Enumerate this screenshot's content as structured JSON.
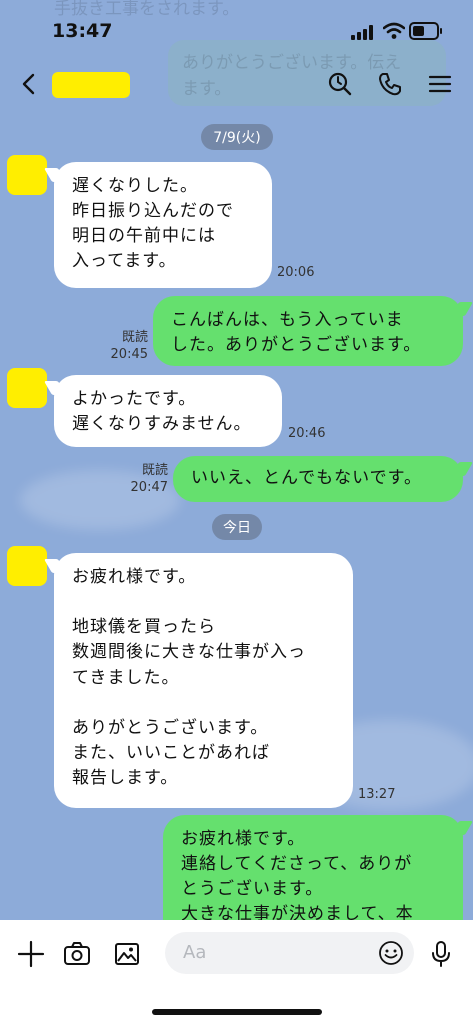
{
  "status_bar": {
    "time": "13:47"
  },
  "background_ghost": {
    "top_text": "手抜き工事をされます。",
    "bubble_line1": "ありがとうございます。伝え",
    "bubble_line2": "ます。"
  },
  "header": {
    "back_icon": "chevron-left-icon",
    "name_redacted": "",
    "icons": [
      "search-icon",
      "phone-icon",
      "menu-icon"
    ]
  },
  "dates": [
    "7/9(火)",
    "今日"
  ],
  "messages": [
    {
      "side": "in",
      "text": "遅くなりした。\n昨日振り込んだので\n明日の午前中には\n入ってます。",
      "time": "20:06"
    },
    {
      "side": "out",
      "text": "こんばんは、もう入っていま\nした。ありがとうございます。",
      "read": "既読",
      "time": "20:45"
    },
    {
      "side": "in",
      "text": "よかったです。\n遅くなりすみません。",
      "time": "20:46"
    },
    {
      "side": "out",
      "text": "いいえ、とんでもないです。",
      "read": "既読",
      "time": "20:47"
    },
    {
      "side": "in",
      "text": "お疲れ様です。\n\n地球儀を買ったら\n数週間後に大きな仕事が入っ\nてきました。\n\nありがとうございます。\nまた、いいことがあれば\n報告します。",
      "time": "13:27"
    },
    {
      "side": "out",
      "text": "お疲れ様です。\n連絡してくださって、ありが\nとうございます。\n大きな仕事が決めまして、本"
    }
  ],
  "input_bar": {
    "placeholder": "Aa",
    "icons": [
      "plus-icon",
      "camera-icon",
      "image-icon",
      "emoji-icon",
      "microphone-icon"
    ]
  },
  "colors": {
    "background": "#8dabd9",
    "incoming": "#ffffff",
    "outgoing": "#65e06e",
    "avatar": "#ffee00",
    "date_pill": "#7488a8"
  }
}
